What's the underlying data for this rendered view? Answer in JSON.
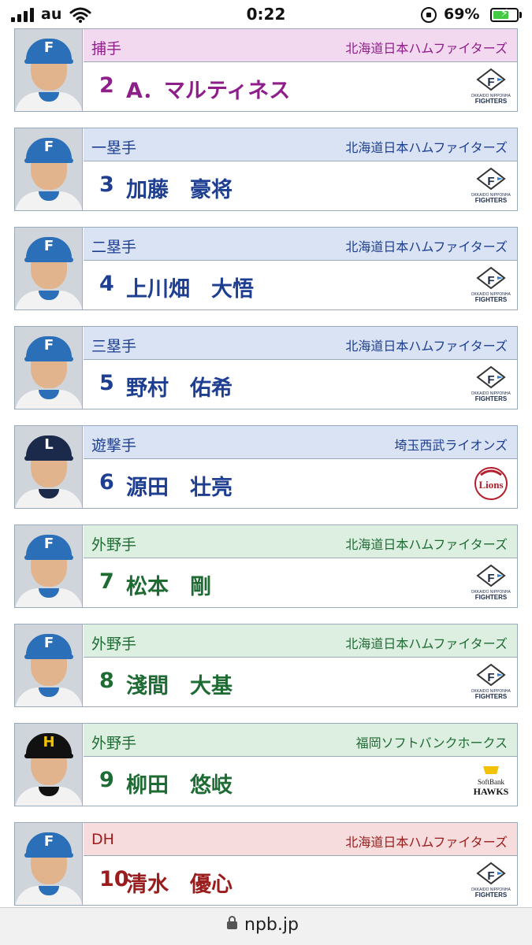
{
  "status_bar": {
    "carrier": "au",
    "time": "0:22",
    "battery_percent": "69%",
    "battery_level": 0.69
  },
  "lineup": [
    {
      "position": "捕手",
      "team": "北海道日本ハムファイターズ",
      "number": "2",
      "name": "A．マルティネス",
      "theme": "catcher",
      "team_logo": "fighters-logo",
      "cap_color": "#2a6fb8"
    },
    {
      "position": "一塁手",
      "team": "北海道日本ハムファイターズ",
      "number": "3",
      "name": "加藤　豪将",
      "theme": "infield",
      "team_logo": "fighters-logo",
      "cap_color": "#2a6fb8"
    },
    {
      "position": "二塁手",
      "team": "北海道日本ハムファイターズ",
      "number": "4",
      "name": "上川畑　大悟",
      "theme": "infield",
      "team_logo": "fighters-logo",
      "cap_color": "#2a6fb8"
    },
    {
      "position": "三塁手",
      "team": "北海道日本ハムファイターズ",
      "number": "5",
      "name": "野村　佑希",
      "theme": "infield",
      "team_logo": "fighters-logo",
      "cap_color": "#2a6fb8"
    },
    {
      "position": "遊撃手",
      "team": "埼玉西武ライオンズ",
      "number": "6",
      "name": "源田　壮亮",
      "theme": "infield",
      "team_logo": "lions-logo",
      "cap_color": "#1b2a4a"
    },
    {
      "position": "外野手",
      "team": "北海道日本ハムファイターズ",
      "number": "7",
      "name": "松本　剛",
      "theme": "outfield",
      "team_logo": "fighters-logo",
      "cap_color": "#2a6fb8"
    },
    {
      "position": "外野手",
      "team": "北海道日本ハムファイターズ",
      "number": "8",
      "name": "淺間　大基",
      "theme": "outfield",
      "team_logo": "fighters-logo",
      "cap_color": "#2a6fb8"
    },
    {
      "position": "外野手",
      "team": "福岡ソフトバンクホークス",
      "number": "9",
      "name": "柳田　悠岐",
      "theme": "outfield",
      "team_logo": "hawks-logo",
      "cap_color": "#111111"
    },
    {
      "position": "DH",
      "team": "北海道日本ハムファイターズ",
      "number": "10",
      "name": "清水　優心",
      "theme": "dh",
      "team_logo": "fighters-logo",
      "cap_color": "#2a6fb8"
    }
  ],
  "url_bar": {
    "domain": "npb.jp"
  }
}
